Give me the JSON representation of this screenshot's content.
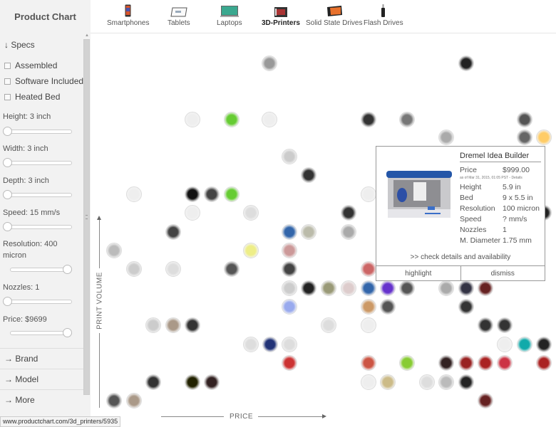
{
  "app": {
    "title": "Product Chart"
  },
  "categories": [
    {
      "id": "smartphones",
      "label": "Smartphones",
      "icon": "smartphone-icon",
      "active": false
    },
    {
      "id": "tablets",
      "label": "Tablets",
      "icon": "tablet-icon",
      "active": false
    },
    {
      "id": "laptops",
      "label": "Laptops",
      "icon": "laptop-icon",
      "active": false
    },
    {
      "id": "3d-printers",
      "label": "3D-Printers",
      "icon": "3d-printer-icon",
      "active": true
    },
    {
      "id": "ssd",
      "label": "Solid State Drives",
      "icon": "ssd-icon",
      "active": false
    },
    {
      "id": "flash",
      "label": "Flash Drives",
      "icon": "flash-drive-icon",
      "active": false
    }
  ],
  "sidebar": {
    "specs_header": "↓ Specs",
    "checkboxes": [
      {
        "label": "Assembled",
        "checked": false
      },
      {
        "label": "Software Included",
        "checked": false
      },
      {
        "label": "Heated Bed",
        "checked": false
      }
    ],
    "filters": [
      {
        "label": "Height: 3 inch",
        "value_fraction": 0.0,
        "range": "min"
      },
      {
        "label": "Width: 3 inch",
        "value_fraction": 0.0,
        "range": "min"
      },
      {
        "label": "Depth: 3 inch",
        "value_fraction": 0.0,
        "range": "min"
      },
      {
        "label": "Speed: 15 mm/s",
        "value_fraction": 0.0,
        "range": "min"
      },
      {
        "label": "Resolution: 400 micron",
        "value_fraction": 1.0,
        "range": "max"
      },
      {
        "label": "Nozzles: 1",
        "value_fraction": 0.0,
        "range": "min"
      },
      {
        "label": "Price: $9699",
        "value_fraction": 1.0,
        "range": "max"
      }
    ],
    "sections": [
      {
        "label": "→ Brand"
      },
      {
        "label": "→ Model"
      },
      {
        "label": "→ More"
      }
    ]
  },
  "chart": {
    "x_axis_label": "PRICE",
    "y_axis_label": "PRINT VOLUME",
    "product_count": 97
  },
  "popup": {
    "title": "Dremel Idea Builder",
    "price_label": "Price",
    "price_value": "$999.00",
    "as_of": "as of Mar 31, 2015, 01:05 PST - Details",
    "specs": [
      {
        "key": "Height",
        "value": "5.9 in"
      },
      {
        "key": "Bed",
        "value": "9 x 5.5 in"
      },
      {
        "key": "Resolution",
        "value": "100 micron"
      },
      {
        "key": "Speed",
        "value": "? mm/s"
      },
      {
        "key": "Nozzles",
        "value": "1"
      },
      {
        "key": "M. Diameter",
        "value": "1.75 mm"
      }
    ],
    "cta": ">> check details and availability",
    "highlight_label": "highlight",
    "dismiss_label": "dismiss"
  },
  "status_bar": {
    "url": "www.productchart.com/3d_printers/5935"
  }
}
